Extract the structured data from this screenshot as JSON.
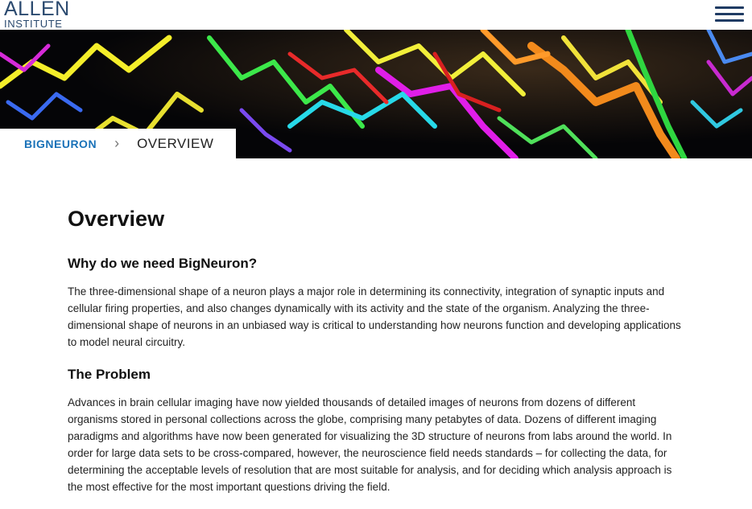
{
  "header": {
    "logo_line1": "ALLEN",
    "logo_line2": "INSTITUTE",
    "menu_icon": "hamburger-menu-icon"
  },
  "breadcrumb": {
    "root": "BIGNEURON",
    "separator_icon": "chevron-right-icon",
    "current": "OVERVIEW"
  },
  "main": {
    "title": "Overview",
    "sections": [
      {
        "heading": "Why do we need BigNeuron?",
        "body": "The three-dimensional shape of a neuron plays a major role in determining its connectivity, integration of synaptic inputs and cellular firing properties, and also changes dynamically with its activity and the state of the organism. Analyzing the three-dimensional shape of neurons in an unbiased way is critical to understanding how neurons function and developing applications to model neural circuitry."
      },
      {
        "heading": "The Problem",
        "body": "Advances in brain cellular imaging have now yielded thousands of detailed images of neurons from dozens of different organisms stored in personal collections across the globe, comprising many petabytes of data. Dozens of different imaging paradigms and algorithms have now been generated for visualizing the 3D structure of neurons from labs around the world. In order for large data sets to be cross-compared, however, the neuroscience field needs standards – for collecting the data, for determining the acceptable levels of resolution that are most suitable for analysis, and for deciding which analysis approach is the most effective for the most important questions driving the field."
      }
    ]
  },
  "colors": {
    "logo": "#2b4a6f",
    "menu": "#1f3b63",
    "link": "#1a72b8",
    "hero_background": "#0a0a0c"
  }
}
